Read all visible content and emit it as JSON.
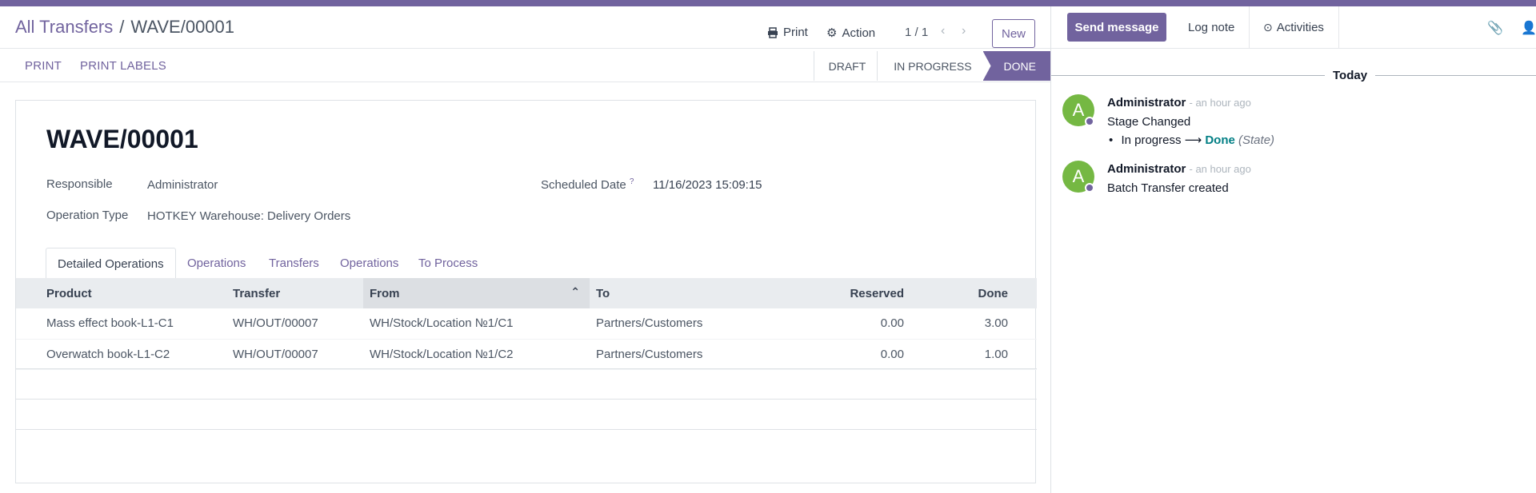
{
  "breadcrumb": {
    "parent": "All Transfers",
    "separator": "/",
    "current": "WAVE/00001"
  },
  "toolbar": {
    "print_label": "Print",
    "action_label": "Action",
    "pager": "1 / 1",
    "new_label": "New"
  },
  "buttons": {
    "print": "PRINT",
    "print_labels": "PRINT LABELS"
  },
  "status": {
    "draft": "DRAFT",
    "in_progress": "IN PROGRESS",
    "done": "DONE"
  },
  "form": {
    "name": "WAVE/00001",
    "responsible_label": "Responsible",
    "responsible": "Administrator",
    "operation_type_label": "Operation Type",
    "operation_type": "HOTKEY Warehouse: Delivery Orders",
    "scheduled_date_label": "Scheduled Date",
    "help_mark": "?",
    "scheduled_date": "11/16/2023 15:09:15"
  },
  "tabs": [
    "Detailed Operations",
    "Operations",
    "Transfers",
    "Operations",
    "To Process"
  ],
  "table": {
    "columns": [
      "Product",
      "Transfer",
      "From",
      "To",
      "Reserved",
      "Done"
    ],
    "rows": [
      [
        "Mass effect book-L1-C1",
        "WH/OUT/00007",
        "WH/Stock/Location №1/C1",
        "Partners/Customers",
        "0.00",
        "3.00"
      ],
      [
        "Overwatch book-L1-C2",
        "WH/OUT/00007",
        "WH/Stock/Location №1/C2",
        "Partners/Customers",
        "0.00",
        "1.00"
      ]
    ]
  },
  "chatter": {
    "send_message": "Send message",
    "log_note": "Log note",
    "activities": "Activities",
    "day_label": "Today",
    "messages": [
      {
        "avatar": "A",
        "author": "Administrator",
        "time": "- an hour ago",
        "title": "Stage Changed",
        "from": "In progress",
        "arrow": "⟶",
        "to": "Done",
        "field": "(State)"
      },
      {
        "avatar": "A",
        "author": "Administrator",
        "time": "- an hour ago",
        "text": "Batch Transfer created"
      }
    ]
  },
  "colors": {
    "brand": "#71639e",
    "avatar": "#75b843",
    "link": "#017e84"
  }
}
